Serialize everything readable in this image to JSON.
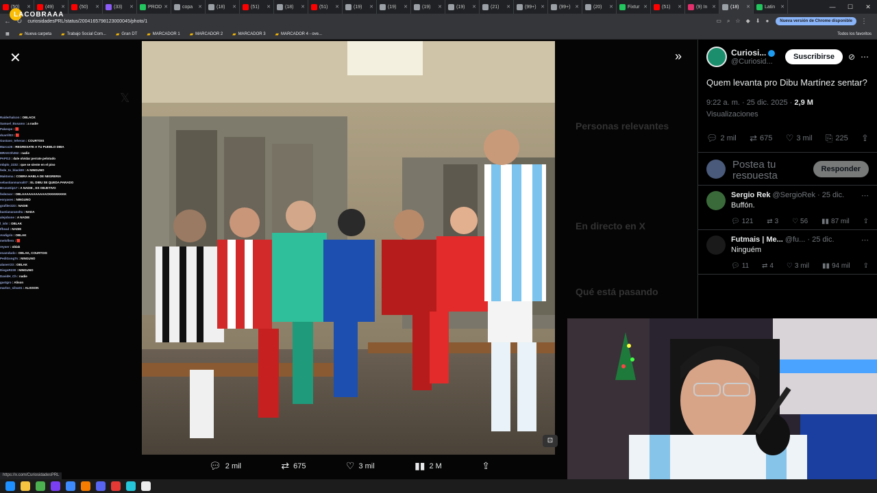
{
  "browser": {
    "tabs": [
      {
        "label": "(50)",
        "color": "#ff0000"
      },
      {
        "label": "(49)",
        "color": "#ff0000"
      },
      {
        "label": "(50)",
        "color": "#ff0000"
      },
      {
        "label": "(33)",
        "color": "#8b5cf6"
      },
      {
        "label": "PROD",
        "color": "#22c55e"
      },
      {
        "label": "copa",
        "color": "#9aa0a6"
      },
      {
        "label": "(18)",
        "color": "#9aa0a6"
      },
      {
        "label": "(51)",
        "color": "#ff0000"
      },
      {
        "label": "(18)",
        "color": "#9aa0a6"
      },
      {
        "label": "(51)",
        "color": "#ff0000"
      },
      {
        "label": "(19)",
        "color": "#9aa0a6"
      },
      {
        "label": "(19)",
        "color": "#9aa0a6"
      },
      {
        "label": "(19)",
        "color": "#9aa0a6"
      },
      {
        "label": "(19)",
        "color": "#9aa0a6"
      },
      {
        "label": "(21)",
        "color": "#9aa0a6"
      },
      {
        "label": "(99+)",
        "color": "#9aa0a6"
      },
      {
        "label": "(99+)",
        "color": "#9aa0a6"
      },
      {
        "label": "(20)",
        "color": "#9aa0a6"
      },
      {
        "label": "Fixtur",
        "color": "#22c55e"
      },
      {
        "label": "(51)",
        "color": "#ff0000"
      },
      {
        "label": "(9) In",
        "color": "#e1306c"
      },
      {
        "label": "(18)",
        "color": "#9aa0a6"
      },
      {
        "label": "Latin",
        "color": "#22c55e"
      }
    ],
    "url": "curiosidadesPRL/status/2004165798123000045/photo/1",
    "update_label": "Nueva versión de Chrome disponible",
    "bookmarks": [
      "Nueva carpeta",
      "Trabajo Social Com...",
      "Gran DT",
      "MARCADOR 1",
      "MARCADOR 2",
      "MARCADOR 3",
      "MARCADOR 4 - ove..."
    ],
    "all_bookmarks": "Todos los favoritos",
    "status_url": "https://x.com/CuriosidadesPRL"
  },
  "stream": {
    "logo": "LACOBRAAA",
    "chat": [
      {
        "user": "Raiderhalcon",
        "msg": "OBLACK"
      },
      {
        "user": "Samuel_Busamo",
        "msg": "a nadie"
      },
      {
        "user": "Pakespe",
        "msg": "🟥"
      },
      {
        "user": "dcarril03",
        "msg": "🟥"
      },
      {
        "user": "Gustavo_teheran",
        "msg": "COURTOIS"
      },
      {
        "user": "Marco26",
        "msg": "REGRESATE A TU PUEBLO DIBA"
      },
      {
        "user": "MRAKOh262",
        "msg": "nadie"
      },
      {
        "user": "PAPI13",
        "msg": "dale olvidar perrate pelotudo"
      },
      {
        "user": "mbplo_2232",
        "msg": "que se siente en el piso"
      },
      {
        "user": "fede_to_black90",
        "msg": "A NINGUNO"
      },
      {
        "user": "Maktoma",
        "msg": "COBRA HABLA DE NEGRERIA"
      },
      {
        "user": "sebastianmarval07",
        "msg": "EL DIBU SE QUEDA PARADO"
      },
      {
        "user": "BrunoDip17",
        "msg": "A NADIE , ES OBJETIVO"
      },
      {
        "user": "fedezxor",
        "msg": "OBLAAAAAAAAAAACKKKKKKKK"
      },
      {
        "user": "eoryases",
        "msg": "NINGUNO"
      },
      {
        "user": "grafiler223",
        "msg": "NADIE"
      },
      {
        "user": "bastianaranoltu",
        "msg": "NADA"
      },
      {
        "user": "alejobone",
        "msg": "A NADIE"
      },
      {
        "user": "l_ishr",
        "msg": "OBLAK"
      },
      {
        "user": "Ifhead",
        "msg": "NADIE"
      },
      {
        "user": "Andigrin",
        "msg": "OBLAK"
      },
      {
        "user": "meloflero",
        "msg": "🟥"
      },
      {
        "user": "reyser",
        "msg": "oblak"
      },
      {
        "user": "enamdudo",
        "msg": "OBLAK, COURTOIS"
      },
      {
        "user": "PediGongTs",
        "msg": "NINGUNO"
      },
      {
        "user": "alanerr23",
        "msg": "OBLAK"
      },
      {
        "user": "DiegoR230",
        "msg": "NINGUNO"
      },
      {
        "user": "DavidH_Ch",
        "msg": "nadie"
      },
      {
        "user": "gastgro",
        "msg": "Alison"
      },
      {
        "user": "marlon_silva01",
        "msg": "ALISSON"
      }
    ]
  },
  "background_sidebar": {
    "items": [
      "Personas relevantes",
      "En directo en X",
      "Qué está pasando"
    ]
  },
  "media_actions": {
    "replies": "2 mil",
    "reposts": "675",
    "likes": "3 mil",
    "views": "2 M"
  },
  "post": {
    "author_name": "Curiosi...",
    "author_handle": "@Curiosid...",
    "subscribe_label": "Suscribirse",
    "text": "Quem levanta pro Dibu Martínez sentar?",
    "time": "9:22 a. m. · 25 dic. 2025 · ",
    "views_count": "2,9 M",
    "views_label": "Visualizaciones",
    "replies": "2 mil",
    "reposts": "675",
    "likes": "3 mil",
    "bookmarks": "225",
    "reply_placeholder": "Postea tu respuesta",
    "reply_button": "Responder"
  },
  "replies": [
    {
      "name": "Sergio Rek",
      "handle": "@SergioRek · 25 dic.",
      "text": "Buffón.",
      "replies": "121",
      "reposts": "3",
      "likes": "56",
      "views": "87 mil",
      "avatar": "#3a6a3a"
    },
    {
      "name": "Futmais | Me...",
      "handle": "@fu... · 25 dic.",
      "text": "Ninguém",
      "replies": "11",
      "reposts": "4",
      "likes": "3 mil",
      "views": "94 mil",
      "avatar": "#1a1a1a"
    }
  ],
  "colors": {
    "accent": "#1d9bf0",
    "bg": "#000000",
    "muted": "#71767b"
  }
}
